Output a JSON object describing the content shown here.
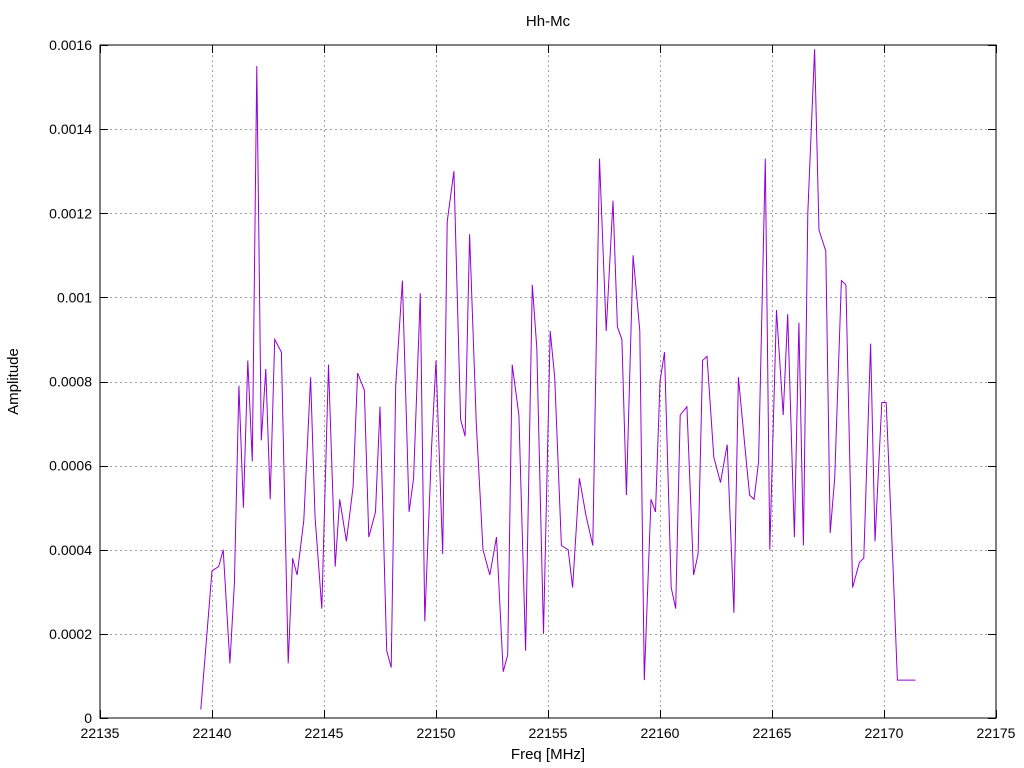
{
  "chart_data": {
    "type": "line",
    "title": "Hh-Mc",
    "xlabel": "Freq [MHz]",
    "ylabel": "Amplitude",
    "xlim": [
      22135,
      22175
    ],
    "ylim": [
      0,
      0.0016
    ],
    "x_ticks": [
      22135,
      22140,
      22145,
      22150,
      22155,
      22160,
      22165,
      22170,
      22175
    ],
    "y_ticks": [
      0,
      0.0002,
      0.0004,
      0.0006,
      0.0008,
      0.001,
      0.0012,
      0.0014,
      0.0016
    ],
    "x_tick_labels": [
      "22135",
      "22140",
      "22145",
      "22150",
      "22155",
      "22160",
      "22165",
      "22170",
      "22175"
    ],
    "y_tick_labels": [
      "0",
      "0.0002",
      "0.0004",
      "0.0006",
      "0.0008",
      "0.001",
      "0.0012",
      "0.0014",
      "0.0016"
    ],
    "grid": true,
    "series": [
      {
        "color": "#9400d3",
        "x": [
          22139.5,
          22140.0,
          22140.3,
          22140.5,
          22140.8,
          22141.0,
          22141.2,
          22141.4,
          22141.6,
          22141.8,
          22142.0,
          22142.2,
          22142.4,
          22142.6,
          22142.8,
          22143.1,
          22143.4,
          22143.6,
          22143.8,
          22144.1,
          22144.4,
          22144.6,
          22144.9,
          22145.2,
          22145.5,
          22145.7,
          22146.0,
          22146.3,
          22146.5,
          22146.8,
          22147.0,
          22147.3,
          22147.5,
          22147.8,
          22148.0,
          22148.2,
          22148.5,
          22148.8,
          22149.0,
          22149.3,
          22149.5,
          22149.8,
          22150.0,
          22150.3,
          22150.5,
          22150.8,
          22151.1,
          22151.3,
          22151.5,
          22151.8,
          22152.1,
          22152.4,
          22152.7,
          22153.0,
          22153.2,
          22153.4,
          22153.7,
          22154.0,
          22154.3,
          22154.5,
          22154.8,
          22155.1,
          22155.3,
          22155.6,
          22155.9,
          22156.1,
          22156.4,
          22156.7,
          22157.0,
          22157.3,
          22157.6,
          22157.9,
          22158.1,
          22158.3,
          22158.5,
          22158.8,
          22159.1,
          22159.3,
          22159.6,
          22159.8,
          22160.0,
          22160.2,
          22160.5,
          22160.7,
          22160.9,
          22161.2,
          22161.5,
          22161.7,
          22161.9,
          22162.1,
          22162.4,
          22162.7,
          22163.0,
          22163.3,
          22163.5,
          22163.8,
          22164.0,
          22164.2,
          22164.4,
          22164.7,
          22164.9,
          22165.2,
          22165.5,
          22165.7,
          22166.0,
          22166.2,
          22166.4,
          22166.6,
          22166.9,
          22167.1,
          22167.4,
          22167.6,
          22167.8,
          22168.1,
          22168.3,
          22168.6,
          22168.9,
          22169.1,
          22169.4,
          22169.6,
          22169.9,
          22170.1,
          22170.4,
          22170.6,
          22170.9,
          22171.1,
          22171.4
        ],
        "y": [
          2e-05,
          0.00035,
          0.00036,
          0.0004,
          0.00013,
          0.00032,
          0.00079,
          0.0005,
          0.00085,
          0.00061,
          0.00155,
          0.00066,
          0.00083,
          0.00052,
          0.0009,
          0.00087,
          0.00013,
          0.00038,
          0.00034,
          0.00047,
          0.00081,
          0.00048,
          0.00026,
          0.00084,
          0.00036,
          0.00052,
          0.00042,
          0.00055,
          0.00082,
          0.00078,
          0.00043,
          0.00049,
          0.00074,
          0.00016,
          0.00012,
          0.00079,
          0.00104,
          0.00049,
          0.00057,
          0.00101,
          0.00023,
          0.00064,
          0.00085,
          0.00039,
          0.00118,
          0.0013,
          0.00071,
          0.00067,
          0.00115,
          0.0007,
          0.0004,
          0.00034,
          0.00043,
          0.00011,
          0.00015,
          0.00084,
          0.00072,
          0.00016,
          0.00103,
          0.00088,
          0.0002,
          0.00092,
          0.00081,
          0.00041,
          0.0004,
          0.00031,
          0.00057,
          0.00048,
          0.00041,
          0.00133,
          0.00092,
          0.00123,
          0.00093,
          0.0009,
          0.00053,
          0.0011,
          0.00092,
          9e-05,
          0.00052,
          0.00049,
          0.0008,
          0.00087,
          0.00031,
          0.00026,
          0.00072,
          0.00074,
          0.00034,
          0.00039,
          0.00085,
          0.00086,
          0.00062,
          0.00056,
          0.00065,
          0.00025,
          0.00081,
          0.00064,
          0.00053,
          0.00052,
          0.00061,
          0.00133,
          0.0004,
          0.00097,
          0.00072,
          0.00096,
          0.00043,
          0.00094,
          0.00041,
          0.0012,
          0.00159,
          0.00116,
          0.00111,
          0.00044,
          0.00057,
          0.00104,
          0.00103,
          0.00031,
          0.00037,
          0.00038,
          0.00089,
          0.00042,
          0.00075,
          0.00075,
          0.00036,
          9e-05,
          9e-05,
          9e-05,
          9e-05
        ]
      }
    ]
  }
}
